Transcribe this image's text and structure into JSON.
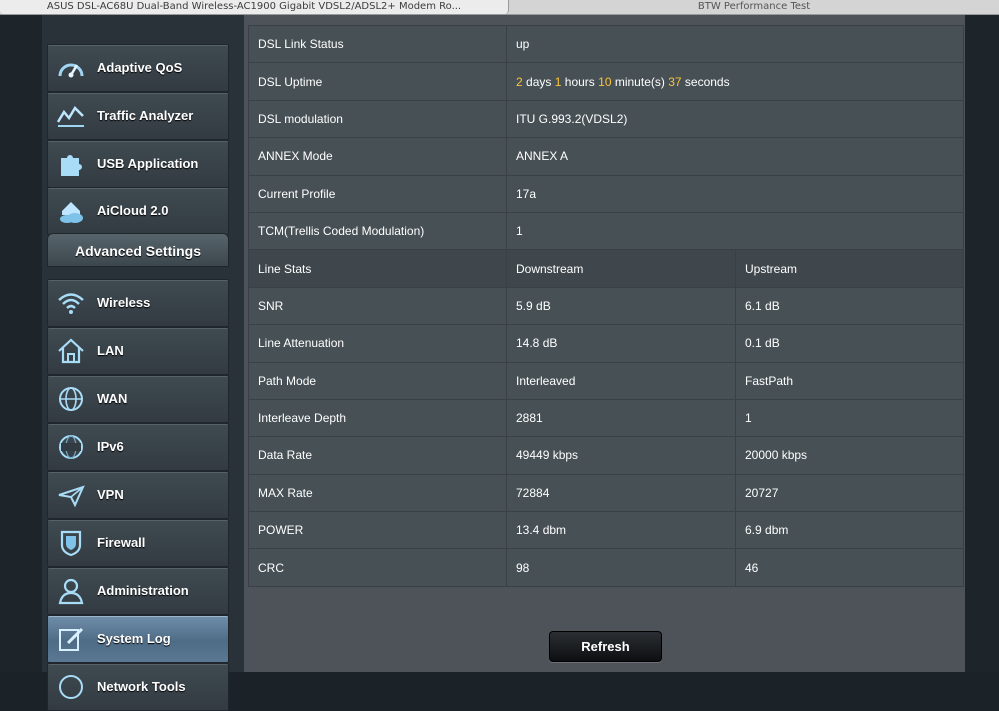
{
  "browser": {
    "tabs": [
      {
        "title": "ASUS DSL-AC68U Dual-Band Wireless-AC1900 Gigabit VDSL2/ADSL2+ Modem Ro..."
      },
      {
        "title": "BTW Performance Test"
      }
    ]
  },
  "sidebar": {
    "general_items": [
      {
        "label": "Adaptive QoS",
        "icon": "speedometer-icon"
      },
      {
        "label": "Traffic Analyzer",
        "icon": "traffic-chart-icon"
      },
      {
        "label": "USB Application",
        "icon": "puzzle-icon"
      },
      {
        "label": "AiCloud 2.0",
        "icon": "cloud-home-icon"
      }
    ],
    "advanced_header": "Advanced Settings",
    "advanced_items": [
      {
        "label": "Wireless",
        "icon": "wifi-icon"
      },
      {
        "label": "LAN",
        "icon": "home-icon"
      },
      {
        "label": "WAN",
        "icon": "globe-icon"
      },
      {
        "label": "IPv6",
        "icon": "ipv6-globe-icon"
      },
      {
        "label": "VPN",
        "icon": "vpn-plane-icon"
      },
      {
        "label": "Firewall",
        "icon": "shield-icon"
      },
      {
        "label": "Administration",
        "icon": "user-icon"
      },
      {
        "label": "System Log",
        "icon": "log-edit-icon",
        "active": true
      },
      {
        "label": "Network Tools",
        "icon": "globe-tools-icon"
      }
    ]
  },
  "dsl": {
    "rows": [
      {
        "label": "DSL Link Status",
        "value": "up"
      },
      {
        "label": "DSL modulation",
        "value": "ITU G.993.2(VDSL2)"
      },
      {
        "label": "ANNEX Mode",
        "value": "ANNEX A"
      },
      {
        "label": "Current Profile",
        "value": "17a"
      },
      {
        "label": "TCM(Trellis Coded Modulation)",
        "value": "1"
      }
    ],
    "uptime": {
      "label": "DSL Uptime",
      "days": "2",
      "days_unit": "days",
      "hours": "1",
      "hours_unit": "hours",
      "minutes": "10",
      "minutes_unit": "minute(s)",
      "seconds": "37",
      "seconds_unit": "seconds"
    },
    "line_stats": {
      "header": {
        "label": "Line Stats",
        "downstream": "Downstream",
        "upstream": "Upstream"
      },
      "rows": [
        {
          "label": "SNR",
          "down": "5.9 dB",
          "up": "6.1 dB"
        },
        {
          "label": "Line Attenuation",
          "down": "14.8 dB",
          "up": "0.1 dB"
        },
        {
          "label": "Path Mode",
          "down": "Interleaved",
          "up": "FastPath"
        },
        {
          "label": "Interleave Depth",
          "down": "2881",
          "up": "1"
        },
        {
          "label": "Data Rate",
          "down": "49449 kbps",
          "up": "20000 kbps"
        },
        {
          "label": "MAX Rate",
          "down": "72884",
          "up": "20727"
        },
        {
          "label": "POWER",
          "down": "13.4 dbm",
          "up": "6.9 dbm"
        },
        {
          "label": "CRC",
          "down": "98",
          "up": "46"
        }
      ]
    }
  },
  "actions": {
    "refresh_label": "Refresh"
  },
  "colors": {
    "highlight": "#fbc33b",
    "active_item": "#5a7893"
  }
}
